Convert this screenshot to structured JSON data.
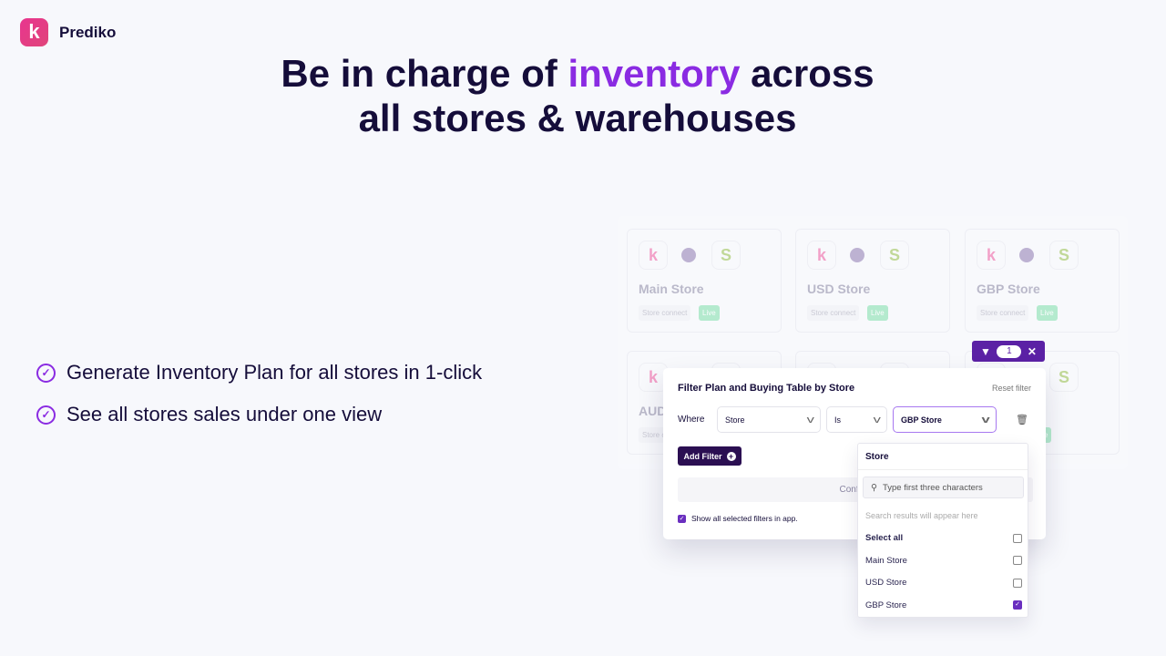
{
  "brand": {
    "logo_letter": "k",
    "name": "Prediko"
  },
  "headline": {
    "part1": "Be in charge of ",
    "accent": "inventory",
    "part2": " across",
    "line2": "all stores & warehouses",
    "accent_color": "#8a2be2"
  },
  "bullets": [
    "Generate Inventory Plan for all stores in 1-click",
    "See all stores sales under one view"
  ],
  "stores": [
    {
      "name": "Main Store",
      "tag": "Store connect",
      "status": "Live"
    },
    {
      "name": "USD Store",
      "tag": "Store connect",
      "status": "Live"
    },
    {
      "name": "GBP Store",
      "tag": "Store connect",
      "status": "Live"
    },
    {
      "name": "AUD",
      "tag": "Store c",
      "status": ""
    },
    {
      "name": "",
      "tag": "",
      "status": ""
    },
    {
      "name": "al Store",
      "tag": "",
      "status": "ve"
    }
  ],
  "filter_pill": {
    "count": "1"
  },
  "modal": {
    "title": "Filter Plan and Buying Table by Store",
    "reset": "Reset filter",
    "where": "Where",
    "field": "Store",
    "operator": "Is",
    "value": "GBP Store",
    "add_filter": "Add Filter",
    "confirm": "Confirm",
    "show_all": "Show all selected filters in app.",
    "show_all_checked": true
  },
  "dropdown": {
    "header": "Store",
    "search_placeholder": "Type first three characters",
    "hint": "Search results will appear here",
    "options": [
      {
        "label": "Select all",
        "checked": false
      },
      {
        "label": "Main Store",
        "checked": false
      },
      {
        "label": "USD Store",
        "checked": false
      },
      {
        "label": "GBP Store",
        "checked": true
      }
    ]
  }
}
